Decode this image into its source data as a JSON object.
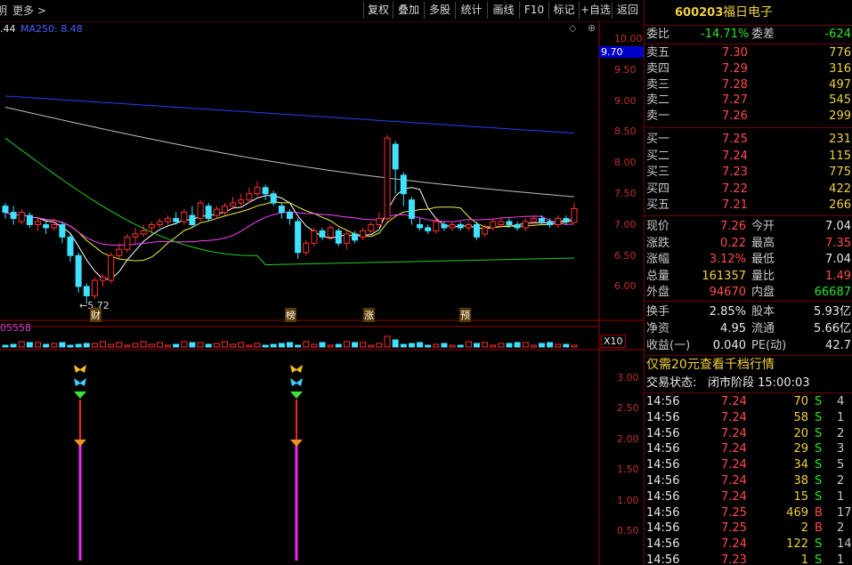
{
  "toolbar": {
    "left_glyph": "明",
    "more_label": "更多",
    "buttons": [
      "复权",
      "叠加",
      "多股",
      "统计",
      "画线",
      "F10",
      "标记",
      "+自选",
      "返回"
    ]
  },
  "indicators": {
    "ma_prev_value": ".44",
    "ma250": "MA250: 8.48",
    "vol_label": "05558",
    "vol_multiplier": "X10"
  },
  "price_axis": {
    "ticks": [
      "10.00",
      "9.50",
      "9.00",
      "8.50",
      "8.00",
      "7.50",
      "7.00",
      "6.50",
      "6.00"
    ],
    "marker": "9.70"
  },
  "sub_axis": {
    "ticks": [
      "3.00",
      "2.50",
      "2.00",
      "1.50",
      "1.00",
      "0.50"
    ]
  },
  "annotations": {
    "low_point": "←5.72",
    "tags": [
      "财",
      "榜",
      "涨",
      "预"
    ]
  },
  "quote": {
    "code": "600203",
    "name": "福日电子",
    "weibi_label": "委比",
    "weibi_value": "-14.71%",
    "weicha_label": "委差",
    "weicha_value": "-624",
    "asks": [
      {
        "label": "卖五",
        "price": "7.30",
        "vol": "776"
      },
      {
        "label": "卖四",
        "price": "7.29",
        "vol": "316"
      },
      {
        "label": "卖三",
        "price": "7.28",
        "vol": "497"
      },
      {
        "label": "卖二",
        "price": "7.27",
        "vol": "545"
      },
      {
        "label": "卖一",
        "price": "7.26",
        "vol": "299"
      }
    ],
    "bids": [
      {
        "label": "买一",
        "price": "7.25",
        "vol": "231"
      },
      {
        "label": "买二",
        "price": "7.24",
        "vol": "115"
      },
      {
        "label": "买三",
        "price": "7.23",
        "vol": "775"
      },
      {
        "label": "买四",
        "price": "7.22",
        "vol": "422"
      },
      {
        "label": "买五",
        "price": "7.21",
        "vol": "266"
      }
    ],
    "stats": [
      {
        "l1": "现价",
        "v1": "7.26",
        "l2": "今开",
        "v2": "7.04"
      },
      {
        "l1": "涨跌",
        "v1": "0.22",
        "l2": "最高",
        "v2": "7.35"
      },
      {
        "l1": "涨幅",
        "v1": "3.12%",
        "l2": "最低",
        "v2": "7.04"
      },
      {
        "l1": "总量",
        "v1": "161357",
        "l2": "量比",
        "v2": "1.49"
      },
      {
        "l1": "外盘",
        "v1": "94670",
        "l2": "内盘",
        "v2": "66687"
      }
    ],
    "stats2": [
      {
        "l1": "换手",
        "v1": "2.85%",
        "l2": "股本",
        "v2": "5.93亿"
      },
      {
        "l1": "净资",
        "v1": "4.95",
        "l2": "流通",
        "v2": "5.66亿"
      },
      {
        "l1": "收益(一)",
        "v1": "0.040",
        "l2": "PE(动)",
        "v2": "42.7"
      }
    ],
    "promo": "仅需20元查看千档行情",
    "status_label": "交易状态:",
    "status_value": "闭市阶段 15:00:03"
  },
  "ticks": [
    {
      "time": "14:56",
      "price": "7.24",
      "vol": "70",
      "side": "S",
      "n": "4"
    },
    {
      "time": "14:56",
      "price": "7.24",
      "vol": "58",
      "side": "S",
      "n": "1"
    },
    {
      "time": "14:56",
      "price": "7.24",
      "vol": "20",
      "side": "S",
      "n": "2"
    },
    {
      "time": "14:56",
      "price": "7.24",
      "vol": "29",
      "side": "S",
      "n": "3"
    },
    {
      "time": "14:56",
      "price": "7.24",
      "vol": "34",
      "side": "S",
      "n": "5"
    },
    {
      "time": "14:56",
      "price": "7.24",
      "vol": "38",
      "side": "S",
      "n": "2"
    },
    {
      "time": "14:56",
      "price": "7.24",
      "vol": "15",
      "side": "S",
      "n": "1"
    },
    {
      "time": "14:56",
      "price": "7.25",
      "vol": "469",
      "side": "B",
      "n": "17"
    },
    {
      "time": "14:56",
      "price": "7.25",
      "vol": "2",
      "side": "B",
      "n": "2"
    },
    {
      "time": "14:56",
      "price": "7.24",
      "vol": "122",
      "side": "S",
      "n": "14"
    },
    {
      "time": "14:56",
      "price": "7.23",
      "vol": "1",
      "side": "S",
      "n": "1"
    }
  ],
  "chart_data": {
    "type": "candlestick",
    "price_range": [
      5.5,
      10.0
    ],
    "candles": [
      [
        7.3,
        7.2,
        7.35,
        7.1
      ],
      [
        7.2,
        7.1,
        7.3,
        7.0
      ],
      [
        7.05,
        7.2,
        7.25,
        7.0
      ],
      [
        7.15,
        7.0,
        7.2,
        6.95
      ],
      [
        7.0,
        7.05,
        7.1,
        6.9
      ],
      [
        7.0,
        6.95,
        7.05,
        6.85
      ],
      [
        6.95,
        7.0,
        7.1,
        6.9
      ],
      [
        7.0,
        6.8,
        7.05,
        6.7
      ],
      [
        6.8,
        6.5,
        6.85,
        6.4
      ],
      [
        6.5,
        6.0,
        6.55,
        5.9
      ],
      [
        6.0,
        5.85,
        6.05,
        5.72
      ],
      [
        5.85,
        6.1,
        6.15,
        5.8
      ],
      [
        6.1,
        6.15,
        6.2,
        6.0
      ],
      [
        6.1,
        6.5,
        6.55,
        6.05
      ],
      [
        6.5,
        6.6,
        6.7,
        6.45
      ],
      [
        6.6,
        6.8,
        6.85,
        6.55
      ],
      [
        6.8,
        6.85,
        6.95,
        6.7
      ],
      [
        6.85,
        6.9,
        7.0,
        6.8
      ],
      [
        6.95,
        7.0,
        7.05,
        6.85
      ],
      [
        7.0,
        7.05,
        7.1,
        6.95
      ],
      [
        7.05,
        7.1,
        7.15,
        7.0
      ],
      [
        7.1,
        7.05,
        7.2,
        7.0
      ],
      [
        7.05,
        7.2,
        7.25,
        7.0
      ],
      [
        7.15,
        7.0,
        7.3,
        6.95
      ],
      [
        7.1,
        7.35,
        7.4,
        7.05
      ],
      [
        7.3,
        7.1,
        7.35,
        7.05
      ],
      [
        7.15,
        7.25,
        7.3,
        7.1
      ],
      [
        7.2,
        7.3,
        7.35,
        7.15
      ],
      [
        7.3,
        7.35,
        7.45,
        7.25
      ],
      [
        7.35,
        7.4,
        7.5,
        7.3
      ],
      [
        7.4,
        7.5,
        7.6,
        7.35
      ],
      [
        7.5,
        7.6,
        7.7,
        7.45
      ],
      [
        7.6,
        7.5,
        7.65,
        7.4
      ],
      [
        7.5,
        7.35,
        7.55,
        7.3
      ],
      [
        7.3,
        7.2,
        7.35,
        7.1
      ],
      [
        7.2,
        7.1,
        7.25,
        7.0
      ],
      [
        7.05,
        6.55,
        7.1,
        6.45
      ],
      [
        6.55,
        6.7,
        6.75,
        6.5
      ],
      [
        6.7,
        6.9,
        6.95,
        6.65
      ],
      [
        6.9,
        6.8,
        6.95,
        6.75
      ],
      [
        6.8,
        6.95,
        7.0,
        6.75
      ],
      [
        6.9,
        6.7,
        6.95,
        6.65
      ],
      [
        6.7,
        6.85,
        6.9,
        6.6
      ],
      [
        6.85,
        6.75,
        6.9,
        6.7
      ],
      [
        6.8,
        6.9,
        6.95,
        6.75
      ],
      [
        6.9,
        7.0,
        7.05,
        6.85
      ],
      [
        7.0,
        7.1,
        7.2,
        6.95
      ],
      [
        7.1,
        8.4,
        8.45,
        7.05
      ],
      [
        8.3,
        7.9,
        8.35,
        7.5
      ],
      [
        7.8,
        7.5,
        7.85,
        7.3
      ],
      [
        7.4,
        7.1,
        7.45,
        7.0
      ],
      [
        7.0,
        6.95,
        7.1,
        6.9
      ],
      [
        6.95,
        6.9,
        7.0,
        6.85
      ],
      [
        6.9,
        7.05,
        7.1,
        6.85
      ],
      [
        7.0,
        6.95,
        7.05,
        6.9
      ],
      [
        6.95,
        7.0,
        7.05,
        6.9
      ],
      [
        7.0,
        6.95,
        7.05,
        6.9
      ],
      [
        6.95,
        7.0,
        7.05,
        6.9
      ],
      [
        7.0,
        6.8,
        7.05,
        6.75
      ],
      [
        6.85,
        6.95,
        7.0,
        6.8
      ],
      [
        6.95,
        7.05,
        7.1,
        6.9
      ],
      [
        7.0,
        7.05,
        7.1,
        6.95
      ],
      [
        7.05,
        7.0,
        7.1,
        6.95
      ],
      [
        7.0,
        6.95,
        7.05,
        6.9
      ],
      [
        6.95,
        7.05,
        7.1,
        6.9
      ],
      [
        7.05,
        7.1,
        7.15,
        7.0
      ],
      [
        7.1,
        7.05,
        7.15,
        7.0
      ],
      [
        7.05,
        7.0,
        7.1,
        6.95
      ],
      [
        7.0,
        7.1,
        7.15,
        6.95
      ],
      [
        7.1,
        7.05,
        7.15,
        7.0
      ],
      [
        7.04,
        7.26,
        7.35,
        7.04
      ]
    ],
    "ma250_end": 8.48
  }
}
